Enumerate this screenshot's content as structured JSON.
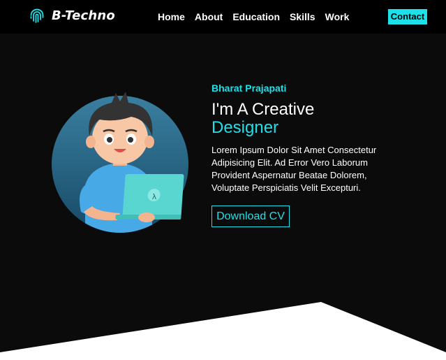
{
  "brand": {
    "name": "B-Techno",
    "icon": "fingerprint-icon"
  },
  "nav": {
    "items": [
      "Home",
      "About",
      "Education",
      "Skills",
      "Work"
    ],
    "contact": "Contact"
  },
  "hero": {
    "name": "Bharat Prajapati",
    "title_line1": "I'm A Creative",
    "title_line2": "Designer",
    "description": "Lorem Ipsum Dolor Sit Amet Consectetur Adipisicing Elit. Ad Error Vero Laborum Provident Aspernatur Beatae Dolorem, Voluptate Perspiciatis Velit Excepturi.",
    "cta": "Download CV",
    "laptop_symbol": "λ"
  },
  "colors": {
    "accent": "#1ee0e8",
    "background": "#0b0b0b",
    "nav_background": "#000000"
  }
}
